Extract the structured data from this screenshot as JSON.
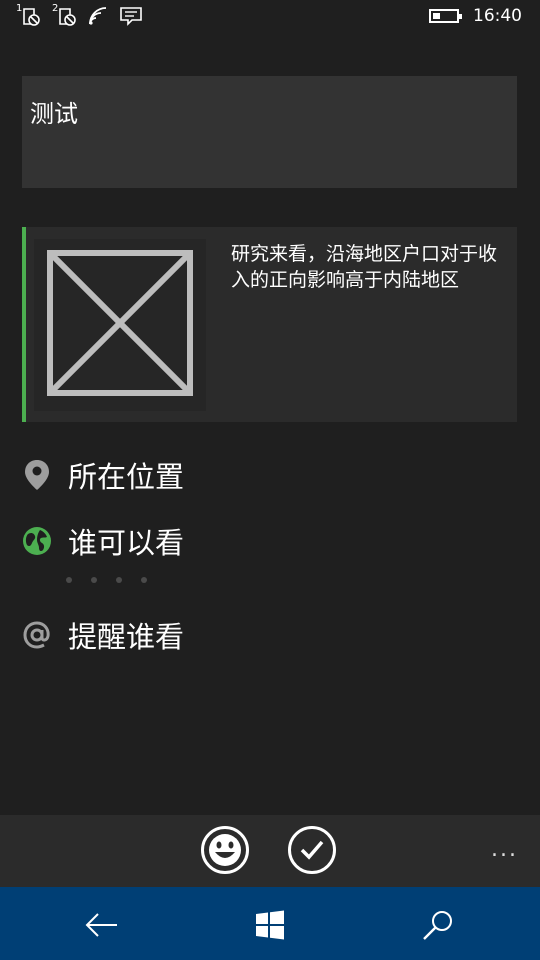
{
  "status_bar": {
    "sim1_label": "1",
    "sim2_label": "2",
    "time": "16:40",
    "battery_level_percent": 30,
    "icons": [
      "sim-signal-icon",
      "sim-signal-icon",
      "wifi-icon",
      "message-icon",
      "battery-icon"
    ]
  },
  "compose": {
    "text": "测试"
  },
  "shared_card": {
    "text": "研究来看，沿海地区户口对于收入的正向影响高于内陆地区",
    "accent_color": "#4caf50"
  },
  "options": {
    "location_label": "所在位置",
    "visibility_label": "谁可以看",
    "mention_label": "提醒谁看"
  },
  "app_bar": {
    "more_label": "..."
  },
  "colors": {
    "background": "#1f1f1f",
    "textbox": "#333333",
    "card": "#2b2b2b",
    "navbar": "#003f75",
    "globe": "#4caf50"
  }
}
